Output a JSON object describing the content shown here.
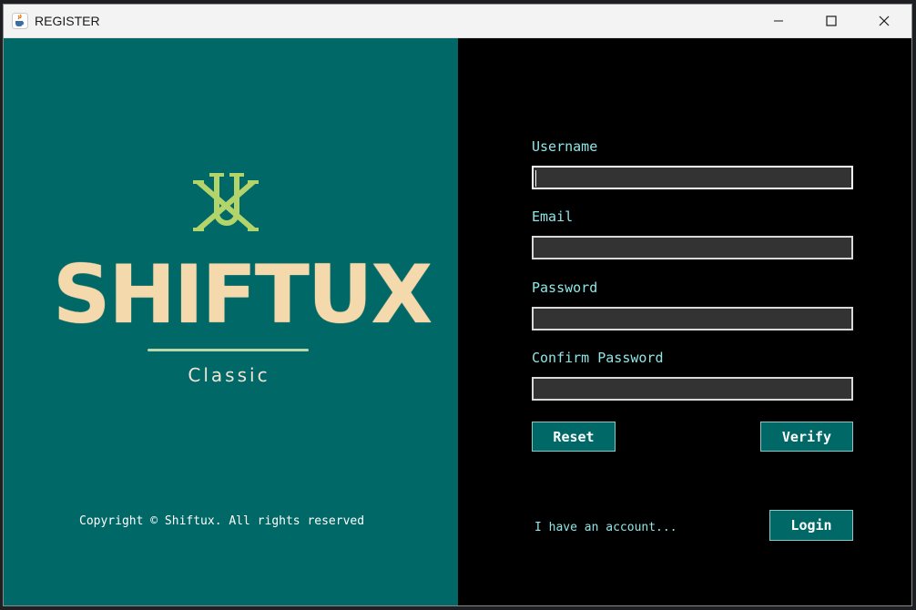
{
  "window": {
    "title": "REGISTER",
    "app_icon": "java-cup-icon",
    "controls": [
      "minimize-icon",
      "maximize-icon",
      "close-icon"
    ]
  },
  "brand": {
    "logo_icon": "shiftux-monogram-logo",
    "name": "SHIFTUX",
    "tagline": "Classic",
    "copyright": "Copyright © Shiftux. All rights reserved"
  },
  "form": {
    "username_label": "Username",
    "username_value": "",
    "email_label": "Email",
    "email_value": "",
    "password_label": "Password",
    "password_value": "",
    "confirm_password_label": "Confirm Password",
    "confirm_password_value": "",
    "reset_label": "Reset",
    "verify_label": "Verify",
    "have_account_text": "I have an account...",
    "login_label": "Login"
  },
  "colors": {
    "brand_teal": "#006866",
    "label_cyan": "#8ee6e6",
    "brand_cream": "#f3d9ac",
    "logo_green": "#b3d36b"
  }
}
